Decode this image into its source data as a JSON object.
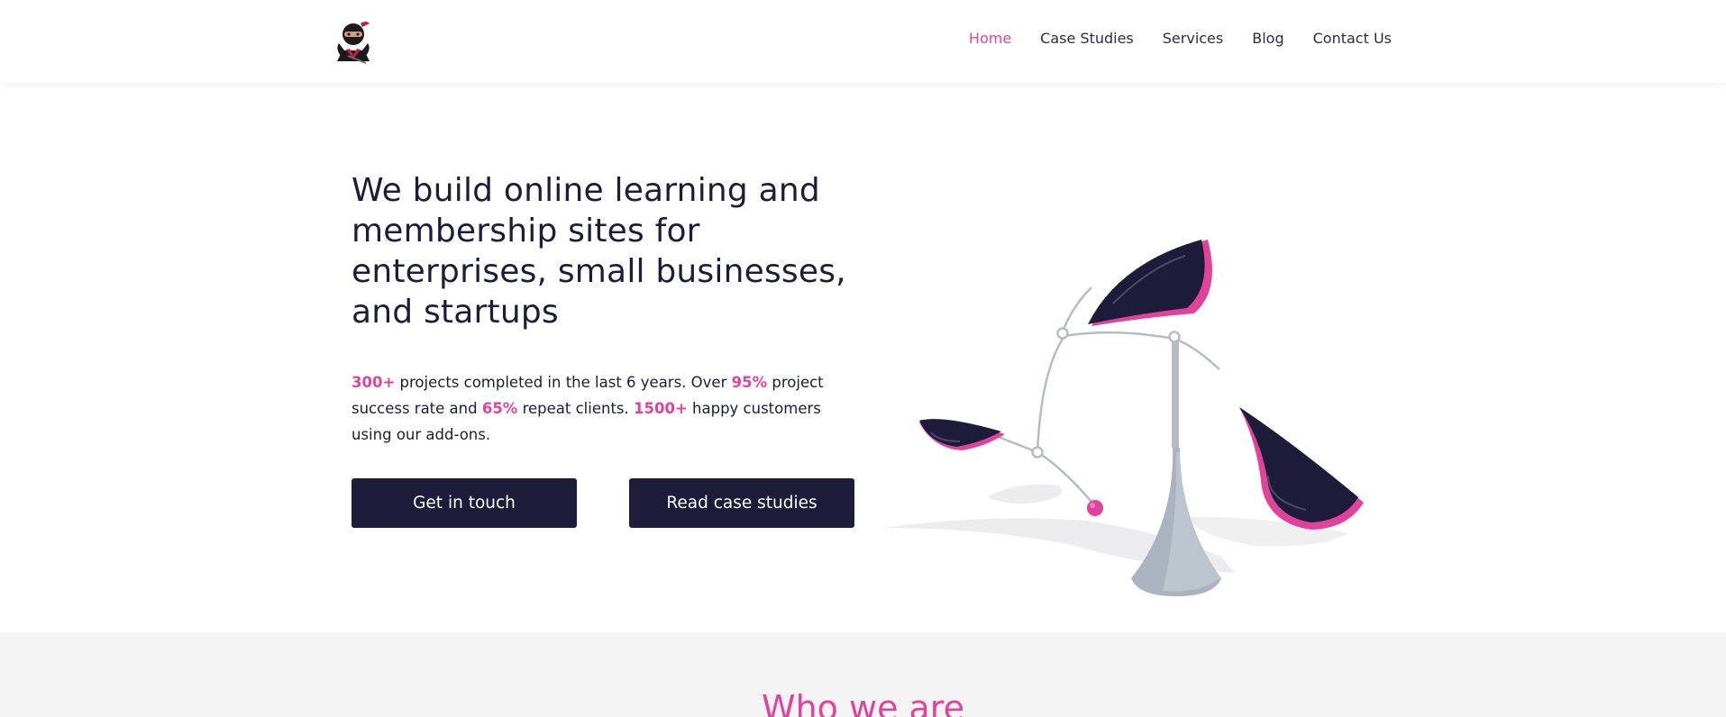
{
  "brand": {
    "logo_icon": "ninja-logo-icon",
    "accent_color": "#e1439a",
    "dark_color": "#1e1c3b"
  },
  "nav": {
    "items": [
      {
        "label": "Home",
        "active": true
      },
      {
        "label": "Case Studies",
        "active": false
      },
      {
        "label": "Services",
        "active": false
      },
      {
        "label": "Blog",
        "active": false
      },
      {
        "label": "Contact Us",
        "active": false
      }
    ]
  },
  "hero": {
    "title": "We build online learning and membership sites for enterprises, small businesses, and startups",
    "stats": {
      "projects_value": "300+",
      "projects_text": " projects completed in the last 6 years. Over ",
      "success_value": "95%",
      "success_text": " project success rate and ",
      "repeat_value": "65%",
      "repeat_text": " repeat clients. ",
      "customers_value": "1500+",
      "customers_text": " happy customers using our add-ons."
    },
    "buttons": {
      "get_in_touch": "Get in touch",
      "read_case_studies": "Read case studies"
    },
    "illustration_icon": "balancing-mobile-illustration"
  },
  "who": {
    "title": "Who we are"
  }
}
